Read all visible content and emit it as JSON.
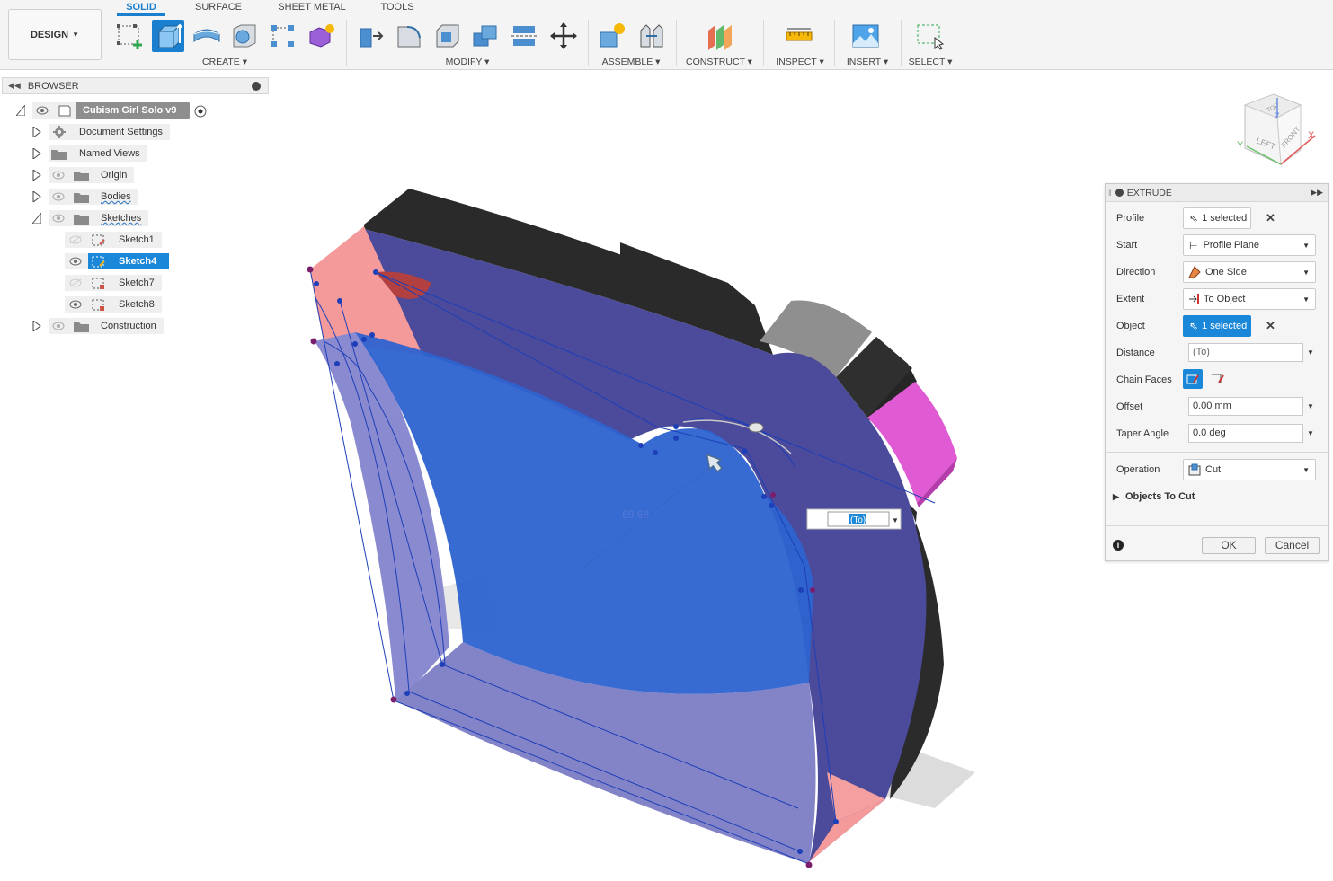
{
  "toolbar": {
    "design_label": "DESIGN",
    "tabs": [
      "SOLID",
      "SURFACE",
      "SHEET METAL",
      "TOOLS"
    ],
    "active_tab": "SOLID",
    "groups": [
      "CREATE",
      "MODIFY",
      "ASSEMBLE",
      "CONSTRUCT",
      "INSPECT",
      "INSERT",
      "SELECT"
    ],
    "accent_color": "#1b7fcf"
  },
  "browser": {
    "title": "BROWSER",
    "root": "Cubism Girl Solo v9",
    "items": [
      {
        "label": "Document Settings",
        "icon": "gear-icon"
      },
      {
        "label": "Named Views",
        "icon": "folder-icon"
      },
      {
        "label": "Origin",
        "icon": "folder-icon"
      },
      {
        "label": "Bodies",
        "icon": "folder-icon"
      },
      {
        "label": "Sketches",
        "icon": "folder-icon"
      },
      {
        "label": "Sketch1",
        "icon": "sketch-icon"
      },
      {
        "label": "Sketch4",
        "icon": "sketch-icon",
        "selected": true
      },
      {
        "label": "Sketch7",
        "icon": "sketch-icon"
      },
      {
        "label": "Sketch8",
        "icon": "sketch-icon"
      },
      {
        "label": "Construction",
        "icon": "folder-icon"
      }
    ]
  },
  "viewcube": {
    "top": "TOP",
    "left": "LEFT",
    "front": "FRONT",
    "x": "X",
    "y": "Y",
    "z": "Z"
  },
  "viewport": {
    "dimension_label": "69.68",
    "distance_input": "(To)"
  },
  "extrude": {
    "title": "EXTRUDE",
    "profile_label": "Profile",
    "profile_value": "1 selected",
    "start_label": "Start",
    "start_value": "Profile Plane",
    "direction_label": "Direction",
    "direction_value": "One Side",
    "extent_label": "Extent",
    "extent_value": "To Object",
    "object_label": "Object",
    "object_value": "1 selected",
    "distance_label": "Distance",
    "distance_value": "(To)",
    "chain_faces_label": "Chain Faces",
    "offset_label": "Offset",
    "offset_value": "0.00 mm",
    "taper_label": "Taper Angle",
    "taper_value": "0.0 deg",
    "operation_label": "Operation",
    "operation_value": "Cut",
    "objects_to_cut": "Objects To Cut",
    "ok_label": "OK",
    "cancel_label": "Cancel"
  }
}
